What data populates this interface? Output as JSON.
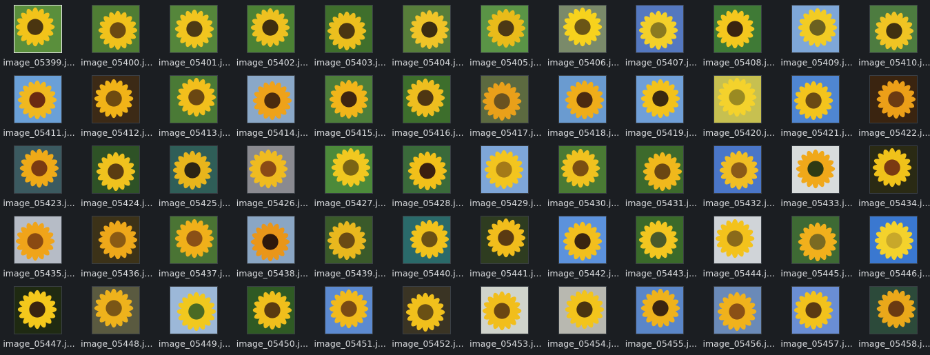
{
  "files": [
    {
      "name": "image_05399.j...",
      "bg": "#5a8f3c",
      "petal": "#f2c31a",
      "center": "#4a3510",
      "icon": "sunflower-thumbnail-icon"
    },
    {
      "name": "image_05400.j...",
      "bg": "#4f7d34",
      "petal": "#f0c21c",
      "center": "#6b4a12",
      "icon": "sunflower-thumbnail-icon"
    },
    {
      "name": "image_05401.j...",
      "bg": "#55863b",
      "petal": "#f1c51f",
      "center": "#4d3a14",
      "icon": "sunflower-thumbnail-icon"
    },
    {
      "name": "image_05402.j...",
      "bg": "#4c8234",
      "petal": "#eec120",
      "center": "#3e2e0f",
      "icon": "sunflower-thumbnail-icon"
    },
    {
      "name": "image_05403.j...",
      "bg": "#3f6f2c",
      "petal": "#ecbf1e",
      "center": "#4a3512",
      "icon": "sunflower-thumbnail-icon"
    },
    {
      "name": "image_05404.j...",
      "bg": "#577e3a",
      "petal": "#f0c428",
      "center": "#3c2c10",
      "icon": "sunflower-thumbnail-icon"
    },
    {
      "name": "image_05405.j...",
      "bg": "#5a9446",
      "petal": "#e9bb1a",
      "center": "#4c3815",
      "icon": "sunflower-thumbnail-icon"
    },
    {
      "name": "image_05406.j...",
      "bg": "#7a8a6a",
      "petal": "#f7d21d",
      "center": "#6a5516",
      "icon": "sunflower-thumbnail-icon"
    },
    {
      "name": "image_05407.j...",
      "bg": "#5478c0",
      "petal": "#f3d02a",
      "center": "#8a7a20",
      "icon": "sunflower-thumbnail-icon"
    },
    {
      "name": "image_05408.j...",
      "bg": "#3f7a36",
      "petal": "#f4c71e",
      "center": "#3a2410",
      "icon": "sunflower-thumbnail-icon"
    },
    {
      "name": "image_05409.j...",
      "bg": "#7ea7d8",
      "petal": "#f2cc24",
      "center": "#6b6020",
      "icon": "sunflower-thumbnail-icon"
    },
    {
      "name": "image_05410.j...",
      "bg": "#4d7c40",
      "petal": "#f0c423",
      "center": "#3f3010",
      "icon": "sunflower-thumbnail-icon"
    },
    {
      "name": "image_05411.j...",
      "bg": "#6aa0d8",
      "petal": "#f0b820",
      "center": "#6a2a12",
      "icon": "sunflower-thumbnail-icon"
    },
    {
      "name": "image_05412.j...",
      "bg": "#3c2a16",
      "petal": "#f1b318",
      "center": "#6e4a10",
      "icon": "sunflower-thumbnail-icon"
    },
    {
      "name": "image_05413.j...",
      "bg": "#4a7a36",
      "petal": "#f2bf1c",
      "center": "#6a4712",
      "icon": "sunflower-thumbnail-icon"
    },
    {
      "name": "image_05414.j...",
      "bg": "#8aa8c8",
      "petal": "#eea21a",
      "center": "#4a2a0e",
      "icon": "sunflower-thumbnail-icon"
    },
    {
      "name": "image_05415.j...",
      "bg": "#4d7e3a",
      "petal": "#f1b51a",
      "center": "#3e2410",
      "icon": "sunflower-thumbnail-icon"
    },
    {
      "name": "image_05416.j...",
      "bg": "#3d6e2c",
      "petal": "#eebe1f",
      "center": "#4e3612",
      "icon": "sunflower-thumbnail-icon"
    },
    {
      "name": "image_05417.j...",
      "bg": "#5c6a40",
      "petal": "#e9a01a",
      "center": "#6a5220",
      "icon": "sunflower-thumbnail-icon"
    },
    {
      "name": "image_05418.j...",
      "bg": "#6a9bd0",
      "petal": "#efad1a",
      "center": "#4c2a10",
      "icon": "sunflower-thumbnail-icon"
    },
    {
      "name": "image_05419.j...",
      "bg": "#6f9fd8",
      "petal": "#f3c21c",
      "center": "#3a2810",
      "icon": "sunflower-thumbnail-icon"
    },
    {
      "name": "image_05420.j...",
      "bg": "#c7c050",
      "petal": "#f4d22c",
      "center": "#9a8a22",
      "icon": "sunflower-thumbnail-icon"
    },
    {
      "name": "image_05421.j...",
      "bg": "#4f86d2",
      "petal": "#f3c41d",
      "center": "#6a4a14",
      "icon": "sunflower-thumbnail-icon"
    },
    {
      "name": "image_05422.j...",
      "bg": "#3a2410",
      "petal": "#ec9f18",
      "center": "#6c3a12",
      "icon": "sunflower-thumbnail-icon"
    },
    {
      "name": "image_05423.j...",
      "bg": "#3b5a60",
      "petal": "#efaa18",
      "center": "#7a3a12",
      "icon": "sunflower-thumbnail-icon"
    },
    {
      "name": "image_05424.j...",
      "bg": "#2e5226",
      "petal": "#f0c21e",
      "center": "#5a3c12",
      "icon": "sunflower-thumbnail-icon"
    },
    {
      "name": "image_05425.j...",
      "bg": "#2f5e58",
      "petal": "#e8b51c",
      "center": "#2c2414",
      "icon": "sunflower-thumbnail-icon"
    },
    {
      "name": "image_05426.j...",
      "bg": "#8a8a90",
      "petal": "#efbb20",
      "center": "#8a4a16",
      "icon": "sunflower-thumbnail-icon"
    },
    {
      "name": "image_05427.j...",
      "bg": "#4c8a3a",
      "petal": "#f1c820",
      "center": "#7a6414",
      "icon": "sunflower-thumbnail-icon"
    },
    {
      "name": "image_05428.j...",
      "bg": "#3a6a3a",
      "petal": "#f2c01a",
      "center": "#3a2010",
      "icon": "sunflower-thumbnail-icon"
    },
    {
      "name": "image_05429.j...",
      "bg": "#7ea6d8",
      "petal": "#f3c51f",
      "center": "#a47a18",
      "icon": "sunflower-thumbnail-icon"
    },
    {
      "name": "image_05430.j...",
      "bg": "#4a7a34",
      "petal": "#f0c21f",
      "center": "#7a4e12",
      "icon": "sunflower-thumbnail-icon"
    },
    {
      "name": "image_05431.j...",
      "bg": "#3d6a2c",
      "petal": "#f0b81c",
      "center": "#6a4612",
      "icon": "sunflower-thumbnail-icon"
    },
    {
      "name": "image_05432.j...",
      "bg": "#4a76c8",
      "petal": "#f0be24",
      "center": "#8a5a18",
      "icon": "sunflower-thumbnail-icon"
    },
    {
      "name": "image_05433.j...",
      "bg": "#d8dcdc",
      "petal": "#f0a81a",
      "center": "#2e3a14",
      "icon": "sunflower-thumbnail-icon"
    },
    {
      "name": "image_05434.j...",
      "bg": "#2a2a14",
      "petal": "#f0c21a",
      "center": "#7a3a12",
      "icon": "sunflower-thumbnail-icon"
    },
    {
      "name": "image_05435.j...",
      "bg": "#b6bcc6",
      "petal": "#f0a41a",
      "center": "#8a4a12",
      "icon": "sunflower-thumbnail-icon"
    },
    {
      "name": "image_05436.j...",
      "bg": "#3c3218",
      "petal": "#eea81a",
      "center": "#8a5a14",
      "icon": "sunflower-thumbnail-icon"
    },
    {
      "name": "image_05437.j...",
      "bg": "#4a7434",
      "petal": "#f0b01a",
      "center": "#8a5016",
      "icon": "sunflower-thumbnail-icon"
    },
    {
      "name": "image_05438.j...",
      "bg": "#8aa6c4",
      "petal": "#e9961a",
      "center": "#2e180c",
      "icon": "sunflower-thumbnail-icon"
    },
    {
      "name": "image_05439.j...",
      "bg": "#3a5a2a",
      "petal": "#e9b81e",
      "center": "#6a4a14",
      "icon": "sunflower-thumbnail-icon"
    },
    {
      "name": "image_05440.j...",
      "bg": "#2a6a6a",
      "petal": "#f1c21c",
      "center": "#6a5014",
      "icon": "sunflower-thumbnail-icon"
    },
    {
      "name": "image_05441.j...",
      "bg": "#2e3c20",
      "petal": "#f1bd1c",
      "center": "#5a3a12",
      "icon": "sunflower-thumbnail-icon"
    },
    {
      "name": "image_05442.j...",
      "bg": "#5c92dc",
      "petal": "#f2bf1e",
      "center": "#3a2410",
      "icon": "sunflower-thumbnail-icon"
    },
    {
      "name": "image_05443.j...",
      "bg": "#3a6a2a",
      "petal": "#f3c620",
      "center": "#4a5a2a",
      "icon": "sunflower-thumbnail-icon"
    },
    {
      "name": "image_05444.j...",
      "bg": "#d0d4d8",
      "petal": "#f3c21c",
      "center": "#8a6a1a",
      "icon": "sunflower-thumbnail-icon"
    },
    {
      "name": "image_05445.j...",
      "bg": "#3e6a34",
      "petal": "#f1b01c",
      "center": "#7a6a22",
      "icon": "sunflower-thumbnail-icon"
    },
    {
      "name": "image_05446.j...",
      "bg": "#3a78d0",
      "petal": "#f4d22c",
      "center": "#c8a82a",
      "icon": "sunflower-thumbnail-icon"
    },
    {
      "name": "image_05447.j...",
      "bg": "#1f2a12",
      "petal": "#f4c81c",
      "center": "#3a2410",
      "icon": "sunflower-thumbnail-icon"
    },
    {
      "name": "image_05448.j...",
      "bg": "#5a5a40",
      "petal": "#eeb21c",
      "center": "#7a5616",
      "icon": "sunflower-thumbnail-icon"
    },
    {
      "name": "image_05449.j...",
      "bg": "#9cb8d8",
      "petal": "#f1c81e",
      "center": "#4a6a24",
      "icon": "sunflower-thumbnail-icon"
    },
    {
      "name": "image_05450.j...",
      "bg": "#2f5a24",
      "petal": "#f0bf1c",
      "center": "#5a3a10",
      "icon": "sunflower-thumbnail-icon"
    },
    {
      "name": "image_05451.j...",
      "bg": "#5c8ad0",
      "petal": "#f1ba1c",
      "center": "#7a4a14",
      "icon": "sunflower-thumbnail-icon"
    },
    {
      "name": "image_05452.j...",
      "bg": "#3a3424",
      "petal": "#f1c01c",
      "center": "#6a5014",
      "icon": "sunflower-thumbnail-icon"
    },
    {
      "name": "image_05453.j...",
      "bg": "#d0d4cc",
      "petal": "#f1be1c",
      "center": "#6a4612",
      "icon": "sunflower-thumbnail-icon"
    },
    {
      "name": "image_05454.j...",
      "bg": "#b8b8b0",
      "petal": "#f2c41c",
      "center": "#4a3410",
      "icon": "sunflower-thumbnail-icon"
    },
    {
      "name": "image_05455.j...",
      "bg": "#5a86c8",
      "petal": "#eeb21c",
      "center": "#3a2410",
      "icon": "sunflower-thumbnail-icon"
    },
    {
      "name": "image_05456.j...",
      "bg": "#6a8ab8",
      "petal": "#f0b21c",
      "center": "#8a5016",
      "icon": "sunflower-thumbnail-icon"
    },
    {
      "name": "image_05457.j...",
      "bg": "#6a8ed4",
      "petal": "#f2c21c",
      "center": "#5a3a12",
      "icon": "sunflower-thumbnail-icon"
    },
    {
      "name": "image_05458.j...",
      "bg": "#2c4a3a",
      "petal": "#eaa81a",
      "center": "#6a3a12",
      "icon": "sunflower-thumbnail-icon"
    }
  ],
  "selected_index": 0
}
